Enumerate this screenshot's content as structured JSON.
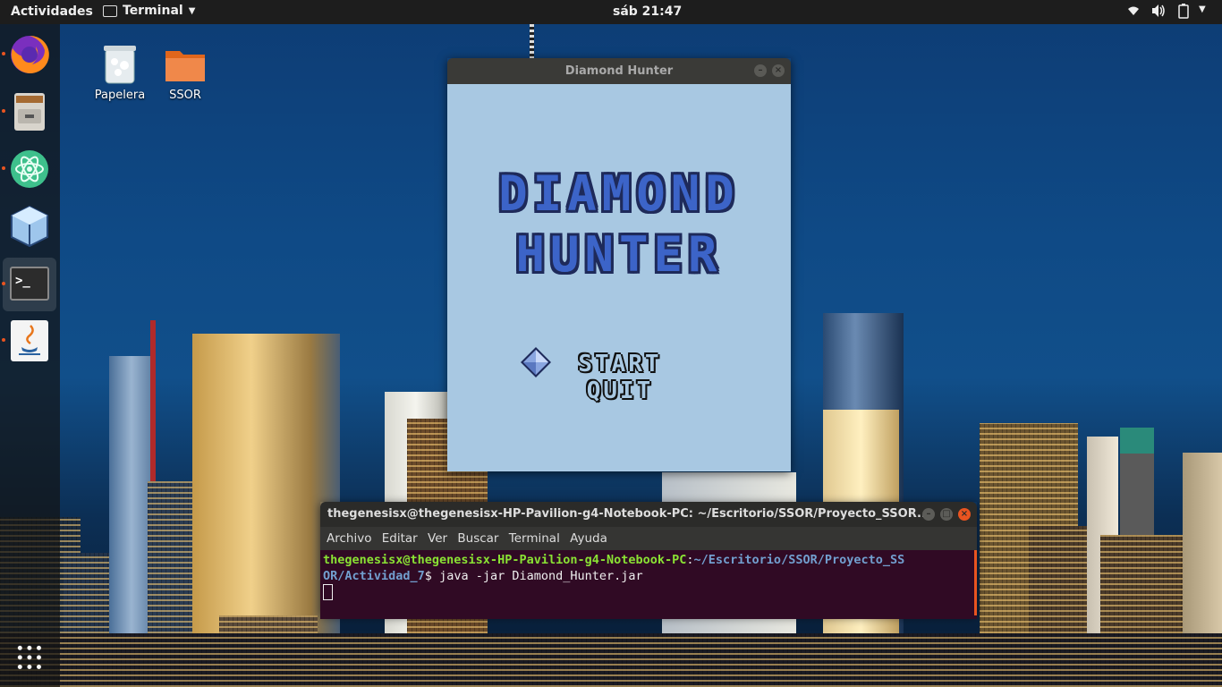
{
  "topbar": {
    "activities": "Actividades",
    "app_menu": "Terminal",
    "clock": "sáb 21:47"
  },
  "desktop": {
    "icons": [
      {
        "label": "Papelera",
        "icon": "trash-icon"
      },
      {
        "label": "SSOR",
        "icon": "folder-icon"
      }
    ]
  },
  "dock": {
    "items": [
      "firefox-icon",
      "file-cabinet-icon",
      "atom-icon",
      "virtualbox-icon",
      "terminal-icon",
      "java-icon"
    ],
    "show_apps": "grid-icon"
  },
  "game_window": {
    "title": "Diamond Hunter",
    "logo_line1": "DIAMOND",
    "logo_line2": "HUNTER",
    "menu": [
      "START",
      "QUIT"
    ],
    "selected": "START"
  },
  "terminal": {
    "title": "thegenesisx@thegenesisx-HP-Pavilion-g4-Notebook-PC: ~/Escritorio/SSOR/Proyecto_SSOR...",
    "menu": [
      "Archivo",
      "Editar",
      "Ver",
      "Buscar",
      "Terminal",
      "Ayuda"
    ],
    "prompt_user": "thegenesisx@thegenesisx-HP-Pavilion-g4-Notebook-PC",
    "prompt_path_1": "~/Escritorio/SSOR/Proyecto_SS",
    "prompt_path_2": "OR/Actividad_7",
    "command": "java -jar Diamond_Hunter.jar"
  },
  "colors": {
    "ubuntu_orange": "#e95420",
    "game_bg": "#a8c8e2",
    "terminal_bg": "#300a24"
  }
}
